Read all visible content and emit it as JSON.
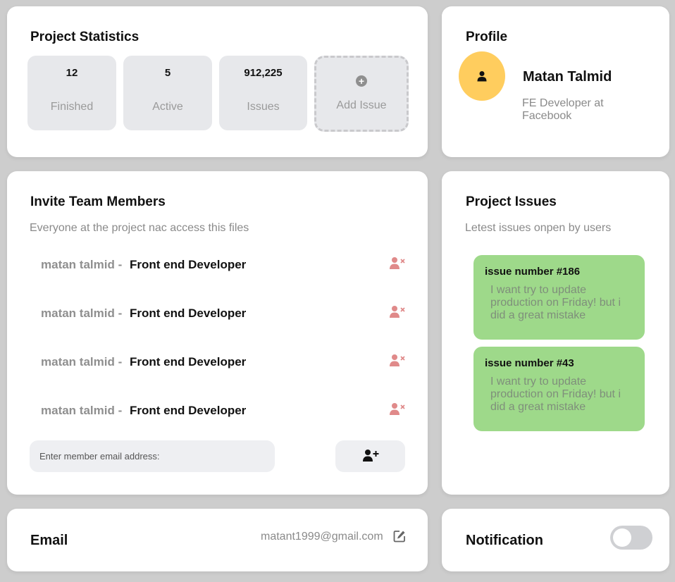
{
  "stats": {
    "title": "Project Statistics",
    "items": [
      {
        "value": "12",
        "label": "Finished"
      },
      {
        "value": "5",
        "label": "Active"
      },
      {
        "value": "912,225",
        "label": "Issues"
      }
    ],
    "add_label": "Add Issue",
    "add_icon": "plus-circle-icon"
  },
  "profile": {
    "title": "Profile",
    "name": "Matan Talmid",
    "role": "FE Developer at Facebook",
    "avatar_icon": "user-icon",
    "avatar_color": "#ffcd5e"
  },
  "invite": {
    "title": "Invite Team Members",
    "subtitle": "Everyone at the project nac access this files",
    "members": [
      {
        "name": "matan talmid -",
        "role": "Front end Developer"
      },
      {
        "name": "matan talmid -",
        "role": "Front end Developer"
      },
      {
        "name": "matan talmid -",
        "role": "Front end Developer"
      },
      {
        "name": "matan talmid -",
        "role": "Front end Developer"
      }
    ],
    "remove_icon": "remove-user-icon",
    "remove_color": "#e08a8a",
    "email_placeholder": "Enter member email address:",
    "add_icon": "add-user-icon"
  },
  "issues": {
    "title": "Project Issues",
    "subtitle": "Letest issues onpen by users",
    "items": [
      {
        "title": "issue number #186",
        "body": "I want try to update production on Friday! but i did a great mistake"
      },
      {
        "title": "issue number #43",
        "body": "I want try to update production on Friday! but i did a great mistake"
      }
    ],
    "card_color": "#9ed98a"
  },
  "email": {
    "label": "Email",
    "value": "matant1999@gmail.com",
    "edit_icon": "edit-icon"
  },
  "notification": {
    "label": "Notification",
    "enabled": false
  }
}
